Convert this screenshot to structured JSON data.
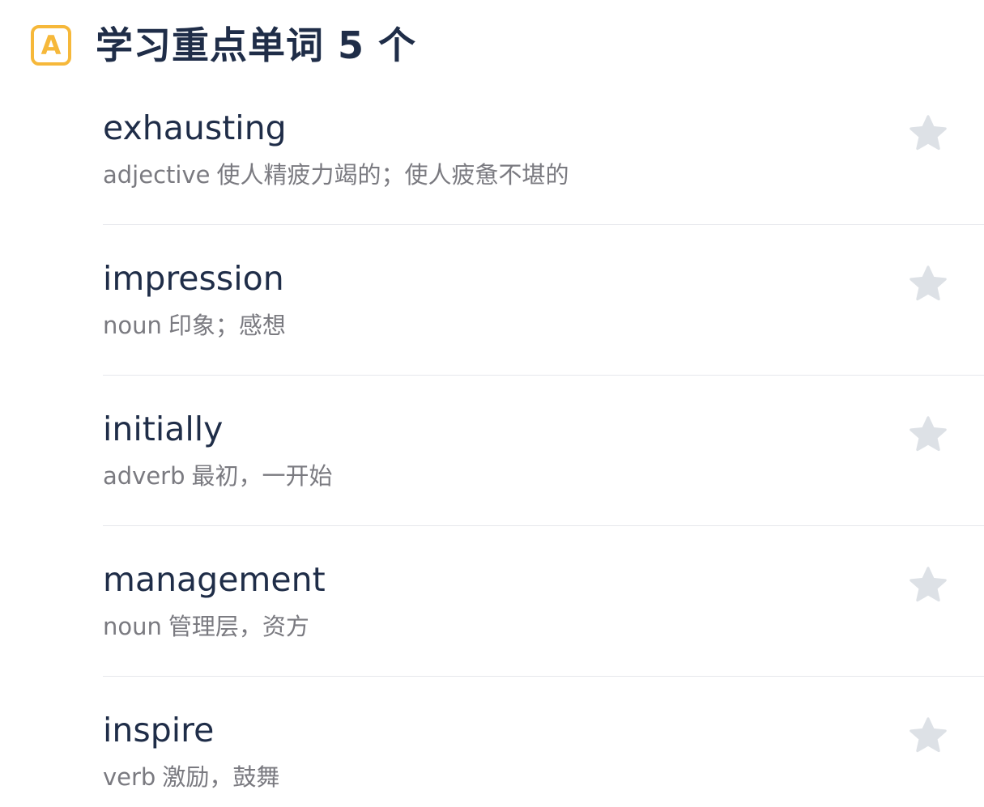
{
  "header": {
    "badge_letter": "A",
    "title": "学习重点单词 5 个",
    "badge_color": "#f6b83a"
  },
  "words": [
    {
      "word": "exhausting",
      "pos": "adjective",
      "meaning": "使人精疲力竭的；使人疲惫不堪的",
      "star_icon": "star-icon"
    },
    {
      "word": "impression",
      "pos": "noun",
      "meaning": "印象；感想",
      "star_icon": "star-icon"
    },
    {
      "word": "initially",
      "pos": "adverb",
      "meaning": "最初，一开始",
      "star_icon": "star-icon"
    },
    {
      "word": "management",
      "pos": "noun",
      "meaning": "管理层，资方",
      "star_icon": "star-icon"
    },
    {
      "word": "inspire",
      "pos": "verb",
      "meaning": "激励，鼓舞",
      "star_icon": "star-icon"
    }
  ],
  "colors": {
    "title_text": "#1f2d48",
    "definition_text": "#7a7a80",
    "star_inactive": "#dde1e6",
    "divider": "#e6e8ec"
  }
}
